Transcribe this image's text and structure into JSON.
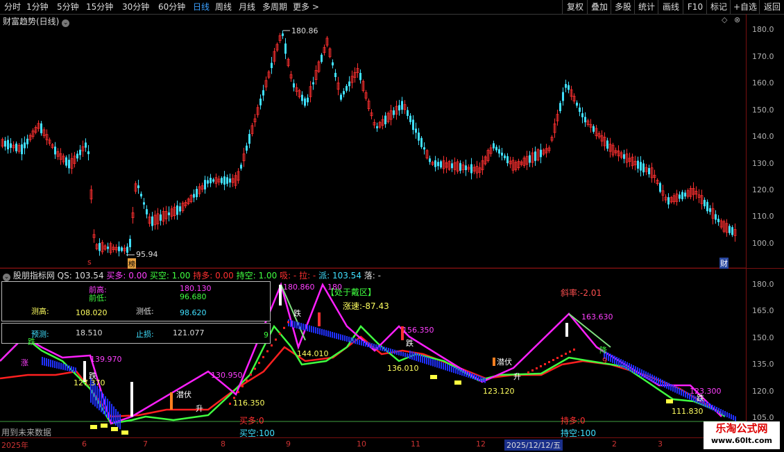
{
  "toolbar": {
    "periods": [
      "分时",
      "1分钟",
      "5分钟",
      "15分钟",
      "30分钟",
      "60分钟",
      "日线",
      "周线",
      "月线",
      "多周期",
      "更多 >"
    ],
    "active": "日线",
    "right_buttons": [
      "复权",
      "叠加",
      "多股",
      "统计",
      "画线",
      "F10",
      "标记",
      "+自选",
      "返回"
    ]
  },
  "main_title": "财富趋势(日线)",
  "main_axis": [
    "180.0",
    "170.0",
    "160.0",
    "150.0",
    "140.0",
    "130.0",
    "120.0",
    "110.0",
    "100.0"
  ],
  "main_marks": {
    "high": "180.86",
    "low": "95.94",
    "badge_low": "榜",
    "badge_right": "财",
    "s_mark": "s"
  },
  "indicator": {
    "name": "股朋指标网",
    "qs": "QS: 103.54",
    "buy_more": "买多: 0.00",
    "buy_empty": "买空: 1.00",
    "hold_more": "持多: 0.00",
    "hold_empty": "持空: 1.00",
    "xi": "吸: -",
    "la": "拉: -",
    "pai": "派: 103.54",
    "luo": "落: -"
  },
  "info_box": {
    "prev_high_label": "前高:",
    "prev_high": "180.130",
    "prev_low_label": "前低:",
    "prev_low": "96.680",
    "test_high_label": "测高:",
    "test_high": "108.020",
    "test_low_label": "测低:",
    "test_low": "98.620",
    "forecast_label": "预测:",
    "forecast": "18.510",
    "stop_label": "止损:",
    "stop": "121.077"
  },
  "ind_axis": [
    "180.0",
    "165.0",
    "150.0",
    "135.0",
    "120.0",
    "105.0"
  ],
  "ind_labels": {
    "zone": "【处于戴区】",
    "speed": "涨速:-87.43",
    "slope": "斜率:-2.01",
    "p180860": "180.860",
    "p163630": "163.630",
    "p139970": "139.970",
    "p127370": "127.370",
    "p130950": "130.950",
    "p116350": "116.350",
    "p144010": "144.010",
    "p156350": "156.350",
    "p136010": "136.010",
    "p123120": "123.120",
    "p123300": "123.300",
    "p111830": "111.830",
    "future": "用到未来数据",
    "buy_more_bottom": "买多:0",
    "hold_more_bottom": "持多:0",
    "buy_empty_bottom": "买空:100",
    "hold_empty_bottom": "持空:100",
    "w_die": "跌",
    "w_zhang": "涨",
    "w_sheng": "升",
    "w_qianfu": "潜伏",
    "w_jiang": "降",
    "w_zhuan": "转",
    "w_nine": "9",
    "w_d180": "180"
  },
  "dates": [
    "2025年",
    "6",
    "7",
    "8",
    "9",
    "10",
    "11",
    "12",
    "2025/12/12/五",
    "2",
    "3"
  ],
  "selected_date": "2025/12/12/五",
  "watermark": {
    "line1": "乐淘公式网",
    "line2": "www.60lt.com"
  },
  "colors": {
    "up": "#ff3030",
    "down": "#40e0ff",
    "magenta": "#ff20ff",
    "green": "#40ff40",
    "yellow": "#ffff40",
    "blue": "#2030ff",
    "red": "#ff2020"
  }
}
